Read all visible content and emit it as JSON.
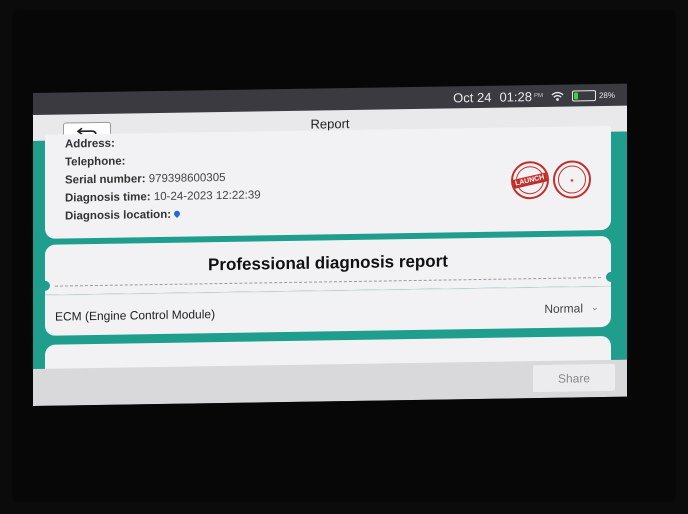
{
  "status_bar": {
    "date": "Oct 24",
    "time": "01:28",
    "meridiem": "PM",
    "battery": "28%",
    "battery_level": 0.28
  },
  "header": {
    "title": "Report",
    "back_icon": "back-arrow-icon"
  },
  "info": {
    "address_label": "Address:",
    "telephone_label": "Telephone:",
    "serial_label": "Serial number:",
    "serial_value": "979398600305",
    "diag_time_label": "Diagnosis time:",
    "diag_time_value": "10-24-2023 12:22:39",
    "diag_location_label": "Diagnosis location:",
    "stamp_text": "LAUNCH"
  },
  "report": {
    "heading": "Professional diagnosis report"
  },
  "modules": [
    {
      "name": "ECM (Engine Control Module)",
      "status": "Normal"
    }
  ],
  "footer": {
    "share_label": "Share"
  },
  "colors": {
    "accent": "#1f9e8d",
    "stamp": "#c0302b"
  }
}
